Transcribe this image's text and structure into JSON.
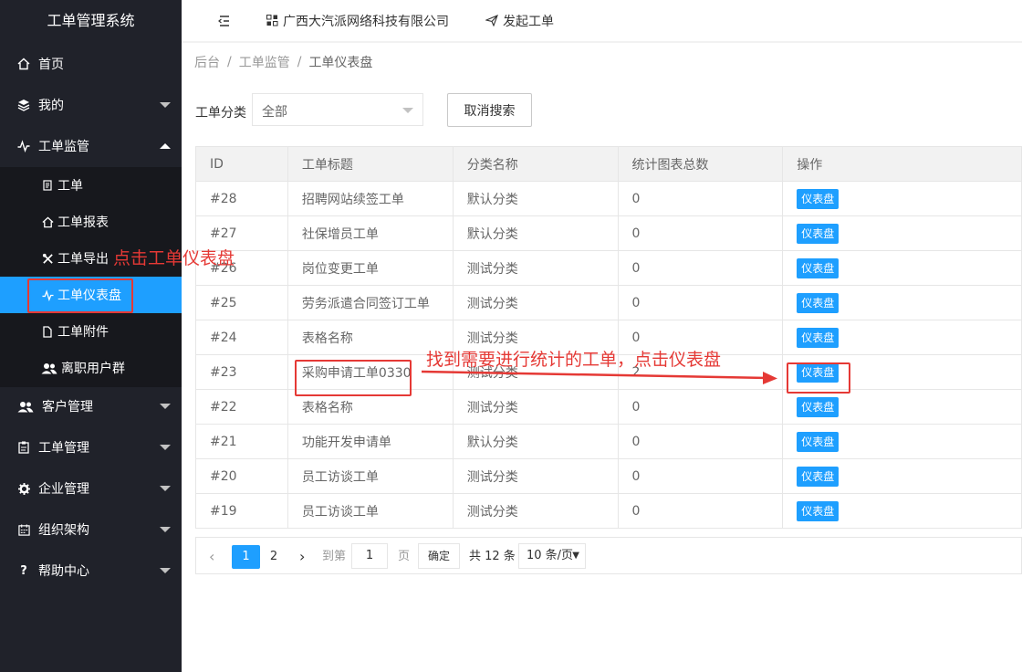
{
  "sidebar": {
    "title": "工单管理系统",
    "items": [
      {
        "label": "首页",
        "icon": "home-icon"
      },
      {
        "label": "我的",
        "icon": "layers-icon"
      },
      {
        "label": "工单监管",
        "icon": "pulse-icon"
      },
      {
        "label": "客户管理",
        "icon": "users-icon"
      },
      {
        "label": "工单管理",
        "icon": "clipboard-icon"
      },
      {
        "label": "企业管理",
        "icon": "gear-icon"
      },
      {
        "label": "组织架构",
        "icon": "calendar-icon"
      },
      {
        "label": "帮助中心",
        "icon": "question-icon"
      }
    ],
    "subitems": [
      {
        "label": "工单",
        "icon": "doc-icon"
      },
      {
        "label": "工单报表",
        "icon": "home-icon"
      },
      {
        "label": "工单导出",
        "icon": "tools-icon"
      },
      {
        "label": "工单仪表盘",
        "icon": "pulse-icon"
      },
      {
        "label": "工单附件",
        "icon": "file-icon"
      },
      {
        "label": "离职用户群",
        "icon": "users-icon"
      }
    ]
  },
  "header": {
    "menu_icon": "☰",
    "company": "广西大汽派网络科技有限公司",
    "create": "发起工单"
  },
  "breadcrumb": [
    "后台",
    "工单监管",
    "工单仪表盘"
  ],
  "filter": {
    "label": "工单分类",
    "selected": "全部",
    "cancel_button": "取消搜索"
  },
  "table": {
    "headers": [
      "ID",
      "工单标题",
      "分类名称",
      "统计图表总数",
      "操作"
    ],
    "rows": [
      {
        "id": "#28",
        "title": "招聘网站续签工单",
        "category": "默认分类",
        "count": "0",
        "action": "仪表盘"
      },
      {
        "id": "#27",
        "title": "社保增员工单",
        "category": "默认分类",
        "count": "0",
        "action": "仪表盘"
      },
      {
        "id": "#26",
        "title": "岗位变更工单",
        "category": "测试分类",
        "count": "0",
        "action": "仪表盘"
      },
      {
        "id": "#25",
        "title": "劳务派遣合同签订工单",
        "category": "测试分类",
        "count": "0",
        "action": "仪表盘"
      },
      {
        "id": "#24",
        "title": "表格名称",
        "category": "测试分类",
        "count": "0",
        "action": "仪表盘"
      },
      {
        "id": "#23",
        "title": "采购申请工单0330",
        "category": "测试分类",
        "count": "2",
        "action": "仪表盘"
      },
      {
        "id": "#22",
        "title": "表格名称",
        "category": "测试分类",
        "count": "0",
        "action": "仪表盘"
      },
      {
        "id": "#21",
        "title": "功能开发申请单",
        "category": "默认分类",
        "count": "0",
        "action": "仪表盘"
      },
      {
        "id": "#20",
        "title": "员工访谈工单",
        "category": "测试分类",
        "count": "0",
        "action": "仪表盘"
      },
      {
        "id": "#19",
        "title": "员工访谈工单",
        "category": "测试分类",
        "count": "0",
        "action": "仪表盘"
      }
    ]
  },
  "pagination": {
    "pages": [
      "1",
      "2"
    ],
    "current": "1",
    "goto_label": "到第",
    "goto_value": "1",
    "page_unit": "页",
    "confirm": "确定",
    "total": "共 12 条",
    "page_size": "10 条/页"
  },
  "annotations": {
    "sidebar_hint": "点击工单仪表盘",
    "table_hint": "找到需要进行统计的工单，点击仪表盘"
  },
  "colors": {
    "sidebar_bg": "#20222a",
    "submenu_bg": "#17181d",
    "active": "#1e9fff",
    "annotation": "#e53935"
  }
}
